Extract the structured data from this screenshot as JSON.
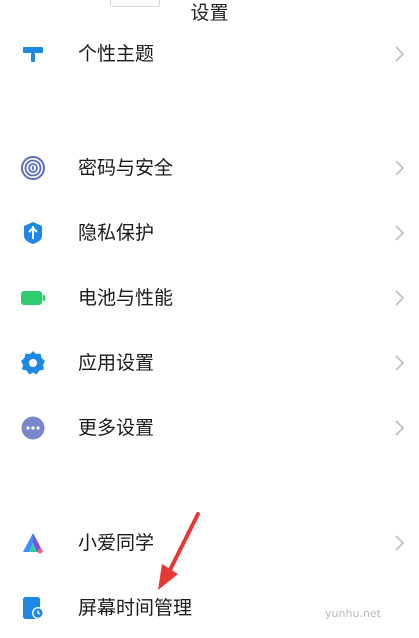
{
  "header": {
    "title": "设置"
  },
  "settings": {
    "items": [
      {
        "label": "个性主题",
        "icon": "theme-brush-icon",
        "color": "#1e88e5"
      },
      {
        "label": "密码与安全",
        "icon": "fingerprint-icon",
        "color": "#5c6bc0"
      },
      {
        "label": "隐私保护",
        "icon": "privacy-shield-icon",
        "color": "#1e88e5"
      },
      {
        "label": "电池与性能",
        "icon": "battery-icon",
        "color": "#2ecc71"
      },
      {
        "label": "应用设置",
        "icon": "gear-icon",
        "color": "#1e88e5"
      },
      {
        "label": "更多设置",
        "icon": "more-dots-icon",
        "color": "#5c6bc0"
      },
      {
        "label": "小爱同学",
        "icon": "xiaoai-assistant-icon",
        "color": "#7b4fe0"
      },
      {
        "label": "屏幕时间管理",
        "icon": "screen-time-icon",
        "color": "#1e88e5"
      }
    ]
  },
  "watermark": {
    "text": "yunhu.net"
  }
}
